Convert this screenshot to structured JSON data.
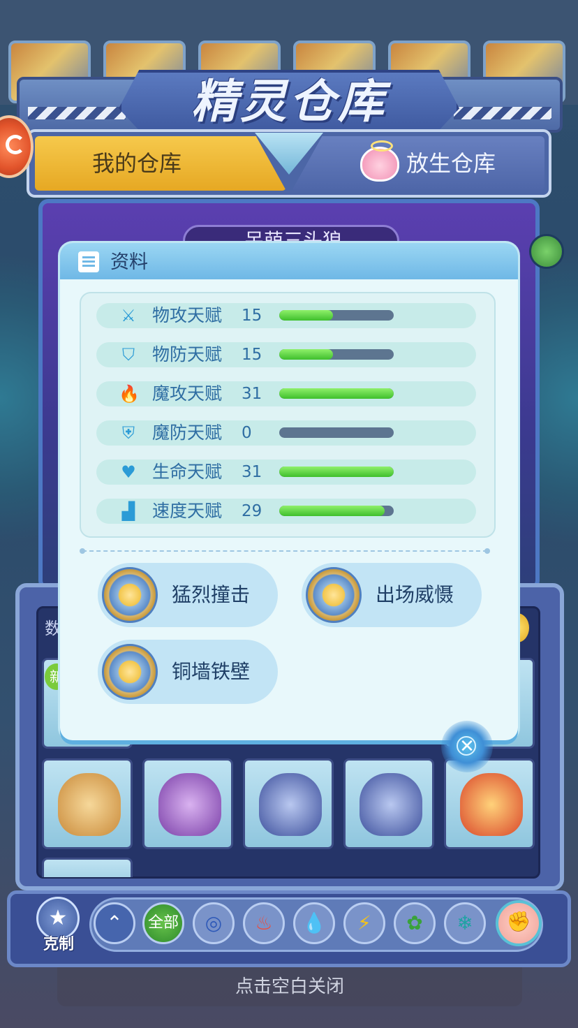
{
  "header": {
    "title": "精灵仓库",
    "tabs": [
      {
        "label": "我的仓库",
        "active": true
      },
      {
        "label": "放生仓库",
        "active": false
      }
    ]
  },
  "pet_name": "呆萌三头狼",
  "popup": {
    "title": "资料",
    "stats": [
      {
        "label": "物攻天赋",
        "value": "15",
        "fill": 0.47,
        "icon": "sword-icon"
      },
      {
        "label": "物防天赋",
        "value": "15",
        "fill": 0.47,
        "icon": "shield-icon"
      },
      {
        "label": "魔攻天赋",
        "value": "31",
        "fill": 1.0,
        "icon": "flame-icon"
      },
      {
        "label": "魔防天赋",
        "value": "0",
        "fill": 0.0,
        "icon": "magic-shield-icon"
      },
      {
        "label": "生命天赋",
        "value": "31",
        "fill": 1.0,
        "icon": "heart-plus-icon"
      },
      {
        "label": "速度天赋",
        "value": "29",
        "fill": 0.92,
        "icon": "boot-icon"
      }
    ],
    "skills": [
      "猛烈撞击",
      "出场威慑",
      "铜墙铁壁"
    ]
  },
  "storage": {
    "label": "数",
    "new_tag": "新"
  },
  "filter_bar": {
    "counter_label": "克制",
    "all_label": "全部",
    "icons": [
      "up-arrow-icon",
      "all",
      "normal-icon",
      "fire-icon",
      "water-icon",
      "electric-icon",
      "grass-icon",
      "ice-icon",
      "fight-icon"
    ]
  },
  "close_hint": "点击空白关闭",
  "colors": {
    "tab_active": "#f6c94c",
    "bar_fill": "#3fbf2d",
    "bar_empty": "#5d7590",
    "popup_bg": "#e8f8fb"
  }
}
